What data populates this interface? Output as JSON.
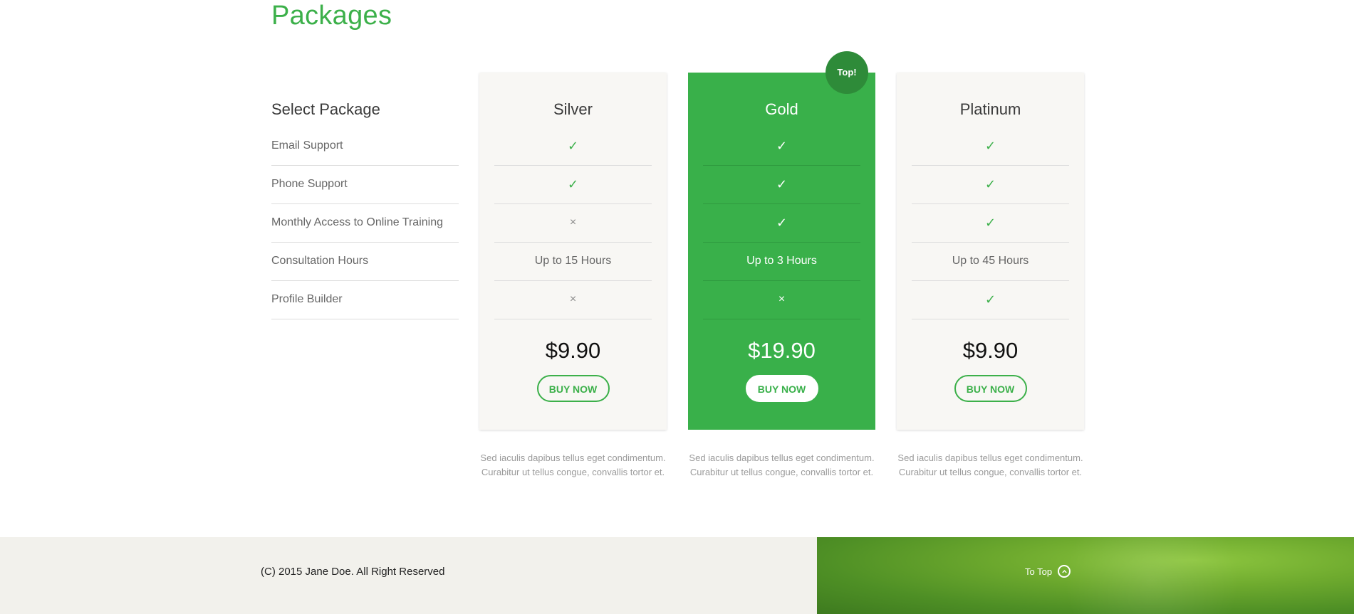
{
  "section": {
    "title": "Packages"
  },
  "features": {
    "heading": "Select Package",
    "rows": [
      "Email Support",
      "Phone Support",
      "Monthly Access to Online Training",
      "Consultation Hours",
      "Profile Builder"
    ]
  },
  "packages": [
    {
      "name": "Silver",
      "featured": false,
      "cells": [
        "✓",
        "✓",
        "×",
        "Up to 15 Hours",
        "×"
      ],
      "price": "$9.90",
      "button": "BUY NOW",
      "description": "Sed iaculis dapibus tellus eget condimentum. Curabitur ut tellus congue, convallis tortor et."
    },
    {
      "name": "Gold",
      "featured": true,
      "badge": "Top!",
      "cells": [
        "✓",
        "✓",
        "✓",
        "Up to 3 Hours",
        "×"
      ],
      "price": "$19.90",
      "button": "BUY NOW",
      "description": "Sed iaculis dapibus tellus eget condimentum. Curabitur ut tellus congue, convallis tortor et."
    },
    {
      "name": "Platinum",
      "featured": false,
      "cells": [
        "✓",
        "✓",
        "✓",
        "Up to 45 Hours",
        "✓"
      ],
      "price": "$9.90",
      "button": "BUY NOW",
      "description": "Sed iaculis dapibus tellus eget condimentum. Curabitur ut tellus congue, convallis tortor et."
    }
  ],
  "footer": {
    "copyright": "(C) 2015 Jane Doe. All Right Reserved",
    "to_top": "To Top",
    "to_top_icon": "chevron-up-circle-icon"
  },
  "colors": {
    "accent": "#3cb04a",
    "featured_bg": "#39b04a",
    "badge_bg": "#2e8b39",
    "card_bg": "#f8f7f4",
    "footer_bg": "#f2f1ec"
  }
}
